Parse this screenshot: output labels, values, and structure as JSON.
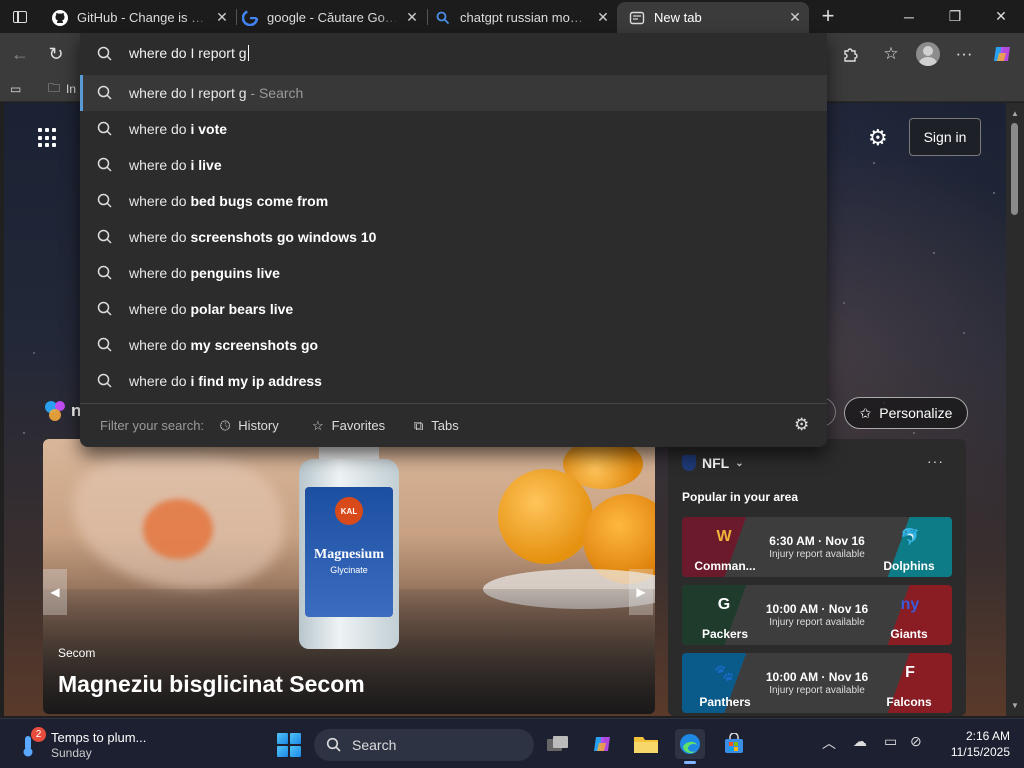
{
  "tabs": [
    {
      "title": "GitHub - Change is const",
      "icon": "github-icon",
      "active": false
    },
    {
      "title": "google - Căutare Google",
      "icon": "google-icon",
      "active": false
    },
    {
      "title": "chatgpt russian mode de",
      "icon": "search-icon",
      "active": false
    },
    {
      "title": "New tab",
      "icon": "newtab-icon",
      "active": true
    }
  ],
  "omnibox": {
    "value": "where do I report g",
    "suggestions": [
      {
        "prefix": "where do I report g",
        "bold": "",
        "hint": " - Search"
      },
      {
        "prefix": "where do ",
        "bold": "i vote",
        "hint": ""
      },
      {
        "prefix": "where do ",
        "bold": "i live",
        "hint": ""
      },
      {
        "prefix": "where do ",
        "bold": "bed bugs come from",
        "hint": ""
      },
      {
        "prefix": "where do ",
        "bold": "screenshots go windows 10",
        "hint": ""
      },
      {
        "prefix": "where do ",
        "bold": "penguins live",
        "hint": ""
      },
      {
        "prefix": "where do ",
        "bold": "polar bears live",
        "hint": ""
      },
      {
        "prefix": "where do ",
        "bold": "my screenshots go",
        "hint": ""
      },
      {
        "prefix": "where do ",
        "bold": "i find my ip address",
        "hint": ""
      }
    ],
    "filter_label": "Filter your search:",
    "filters": [
      "History",
      "Favorites",
      "Tabs"
    ]
  },
  "favbar": {
    "item_text": "In"
  },
  "page": {
    "signin_label": "Sign in",
    "brand_fragment": "n",
    "personalize_label": "Personalize",
    "hero": {
      "source": "Secom",
      "title": "Magneziu bisglicinat Secom",
      "bottle_brand": "KAL",
      "bottle_name": "Magnesium",
      "bottle_sub": "Glycinate"
    },
    "nfl": {
      "title": "NFL",
      "subtitle": "Popular in your area",
      "games": [
        {
          "left": "Comman...",
          "right": "Dolphins",
          "time": "6:30 AM · Nov 16",
          "status": "Injury report available",
          "left_color": "#6b1a2b",
          "right_color": "#0e7c86",
          "left_logo": "W",
          "right_logo": "🐬"
        },
        {
          "left": "Packers",
          "right": "Giants",
          "time": "10:00 AM · Nov 16",
          "status": "Injury report available",
          "left_color": "#1f3b2c",
          "right_color": "#1f3a8a",
          "left_logo": "G",
          "right_logo": "ny"
        },
        {
          "left": "Panthers",
          "right": "Falcons",
          "time": "10:00 AM · Nov 16",
          "status": "Injury report available",
          "left_color": "#0a5b8a",
          "right_color": "#8a1c24",
          "left_logo": "🐾",
          "right_logo": "F"
        }
      ]
    }
  },
  "taskbar": {
    "weather_badge": "2",
    "weather_line1": "Temps to plum...",
    "weather_line2": "Sunday",
    "search_label": "Search",
    "time": "2:16 AM",
    "date": "11/15/2025"
  },
  "colors": {
    "accent": "#5b9bd5",
    "copilot": "#7b61ff"
  }
}
